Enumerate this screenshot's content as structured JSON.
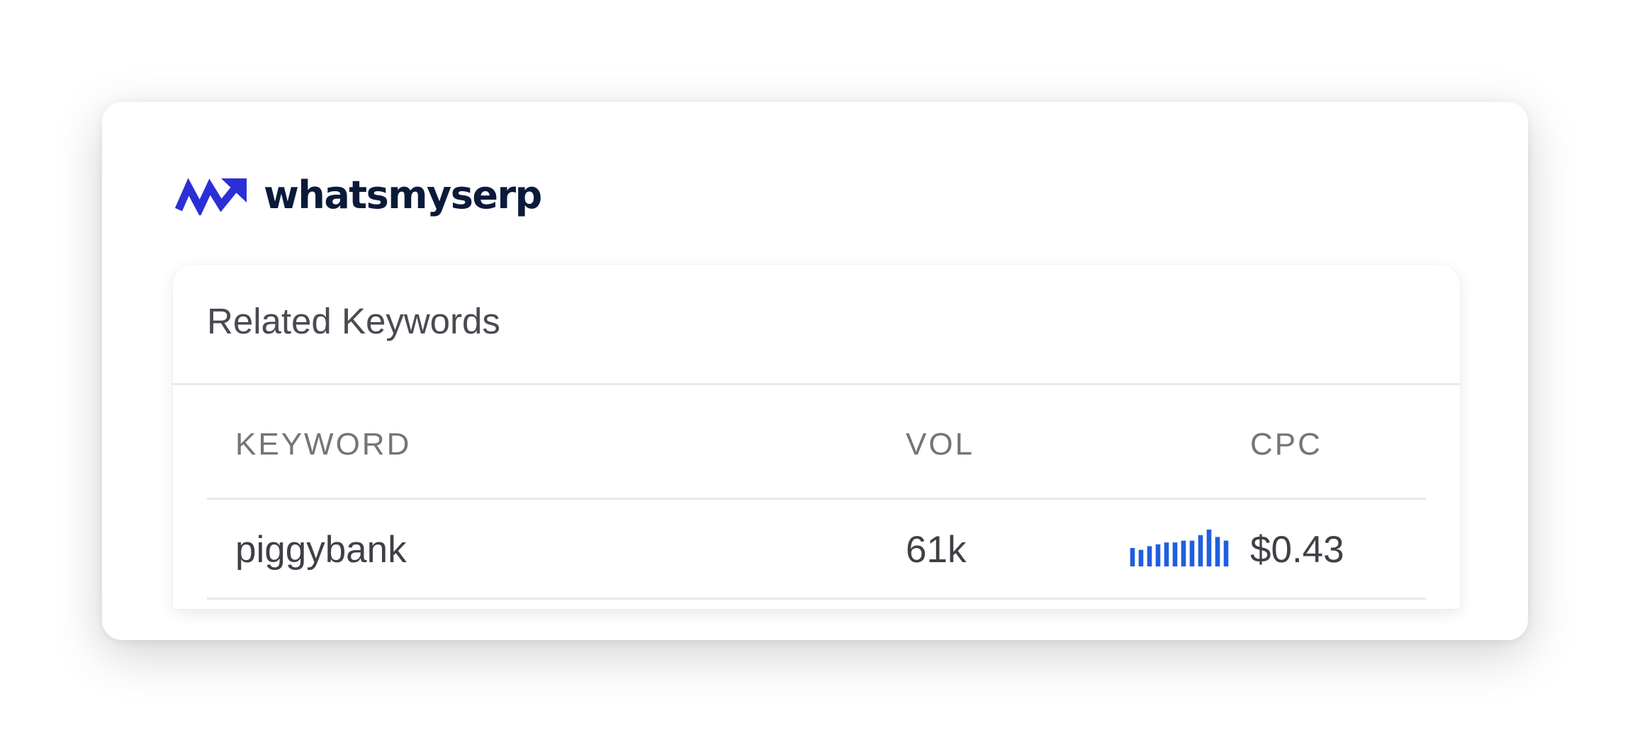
{
  "brand": {
    "name": "whatsmyserp",
    "icon": "trending-up-zigzag-icon",
    "icon_color": "#2b2fd6",
    "text_color": "#0c1a3a"
  },
  "widget": {
    "title": "Related Keywords",
    "columns": {
      "keyword": "KEYWORD",
      "vol": "VOL",
      "cpc": "CPC"
    },
    "rows": [
      {
        "keyword": "piggybank",
        "vol": "61k",
        "cpc": "$0.43",
        "trend": [
          0.5,
          0.45,
          0.55,
          0.6,
          0.65,
          0.65,
          0.7,
          0.7,
          0.85,
          1.0,
          0.8,
          0.7
        ],
        "trend_color": "#1f5fe0"
      }
    ]
  }
}
